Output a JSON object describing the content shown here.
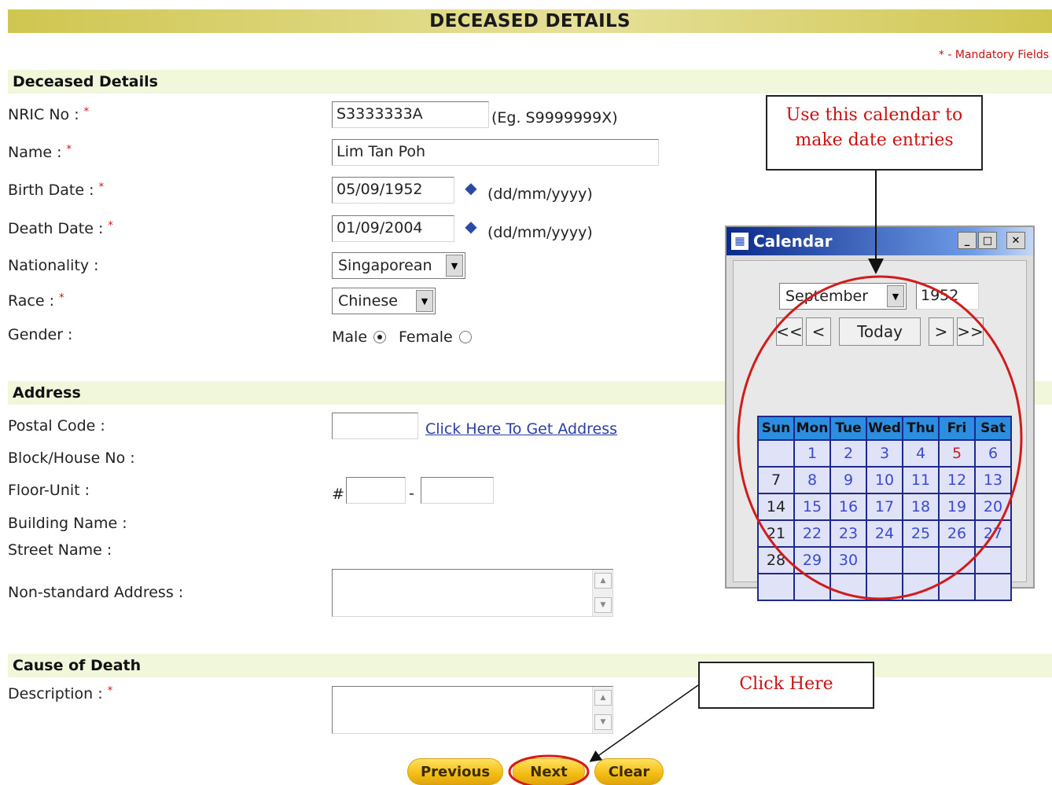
{
  "page": {
    "title": "DECEASED DETAILS",
    "mandatory_note": "* - Mandatory Fields"
  },
  "sections": {
    "deceased": "Deceased Details",
    "address": "Address",
    "cause": "Cause of Death"
  },
  "fields": {
    "nric": {
      "label": "NRIC No :",
      "value": "S3333333A",
      "hint": "(Eg. S9999999X)"
    },
    "name": {
      "label": "Name :",
      "value": "Lim Tan Poh"
    },
    "birth_date": {
      "label": "Birth Date :",
      "value": "05/09/1952",
      "hint": "(dd/mm/yyyy)"
    },
    "death_date": {
      "label": "Death Date :",
      "value": "01/09/2004",
      "hint": "(dd/mm/yyyy)"
    },
    "nationality": {
      "label": "Nationality :",
      "value": "Singaporean"
    },
    "race": {
      "label": "Race :",
      "value": "Chinese"
    },
    "gender": {
      "label": "Gender :",
      "options": [
        "Male",
        "Female"
      ],
      "selected": "Male"
    },
    "postal_code": {
      "label": "Postal Code :",
      "value": "",
      "link": "Click Here To Get Address"
    },
    "block": {
      "label": "Block/House No :"
    },
    "floor_unit": {
      "label": "Floor-Unit :",
      "prefix": "#",
      "separator": "-",
      "floor": "",
      "unit": ""
    },
    "building": {
      "label": "Building Name :"
    },
    "street": {
      "label": "Street Name :"
    },
    "nonstandard": {
      "label": "Non-standard Address :",
      "value": ""
    },
    "description": {
      "label": "Description :",
      "value": ""
    }
  },
  "required_marker": "*",
  "buttons": {
    "previous": "Previous",
    "next": "Next",
    "clear": "Clear"
  },
  "annotations": {
    "calendar_note": "Use this calendar to make date entries",
    "click_note": "Click Here"
  },
  "calendar": {
    "window_title": "Calendar",
    "month": "September",
    "year": "1952",
    "nav": {
      "first": "<<",
      "prev": "<",
      "today": "Today",
      "next": ">",
      "last": ">>"
    },
    "weekdays": [
      "Sun",
      "Mon",
      "Tue",
      "Wed",
      "Thu",
      "Fri",
      "Sat"
    ],
    "weeks": [
      [
        "",
        "1",
        "2",
        "3",
        "4",
        "5",
        "6"
      ],
      [
        "7",
        "8",
        "9",
        "10",
        "11",
        "12",
        "13"
      ],
      [
        "14",
        "15",
        "16",
        "17",
        "18",
        "19",
        "20"
      ],
      [
        "21",
        "22",
        "23",
        "24",
        "25",
        "26",
        "27"
      ],
      [
        "28",
        "29",
        "30",
        "",
        "",
        "",
        ""
      ],
      [
        "",
        "",
        "",
        "",
        "",
        "",
        ""
      ]
    ],
    "highlight_day": "5"
  },
  "colors": {
    "title_bar": "#d4cc5c",
    "section_bar": "#f1f7da",
    "required": "#cc1111",
    "link": "#2a3ea8",
    "button": "#f5bf17",
    "annotation_ring": "#d21c1c"
  }
}
